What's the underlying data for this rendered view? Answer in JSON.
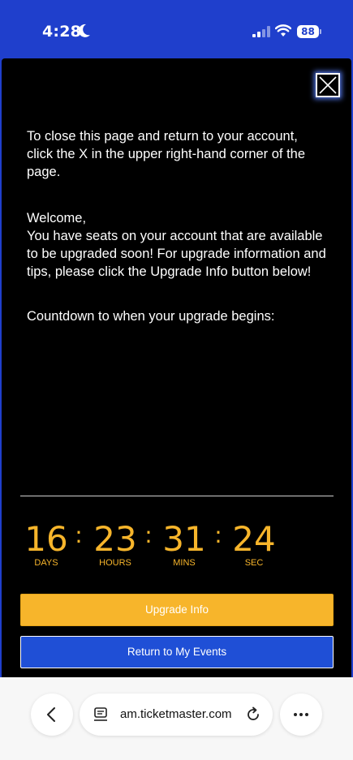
{
  "status_bar": {
    "time": "4:28",
    "battery": "88",
    "background": "#1f3fcc"
  },
  "page": {
    "close_instructions": "To close this page and return to your account, click the X in the upper right-hand corner of the page.",
    "welcome_line": "Welcome,",
    "welcome_body": "You have seats on your account that are available to be upgraded soon! For upgrade information and tips, please click the Upgrade Info button below!",
    "countdown_label": "Countdown to when your upgrade begins:"
  },
  "countdown": {
    "days": "16",
    "hours": "23",
    "mins": "31",
    "sec": "24",
    "days_label": "DAYS",
    "hours_label": "HOURS",
    "mins_label": "MINS",
    "sec_label": "SEC",
    "separator": ":",
    "color": "#f7b52b"
  },
  "buttons": {
    "upgrade_label": "Upgrade Info",
    "return_label": "Return to My Events",
    "upgrade_color": "#f7b52b",
    "return_color": "#1f4fd6"
  },
  "browser": {
    "url": "am.ticketmaster.com",
    "icons": [
      "chevron-left-icon",
      "site-settings-icon",
      "reload-icon",
      "more-icon"
    ]
  }
}
